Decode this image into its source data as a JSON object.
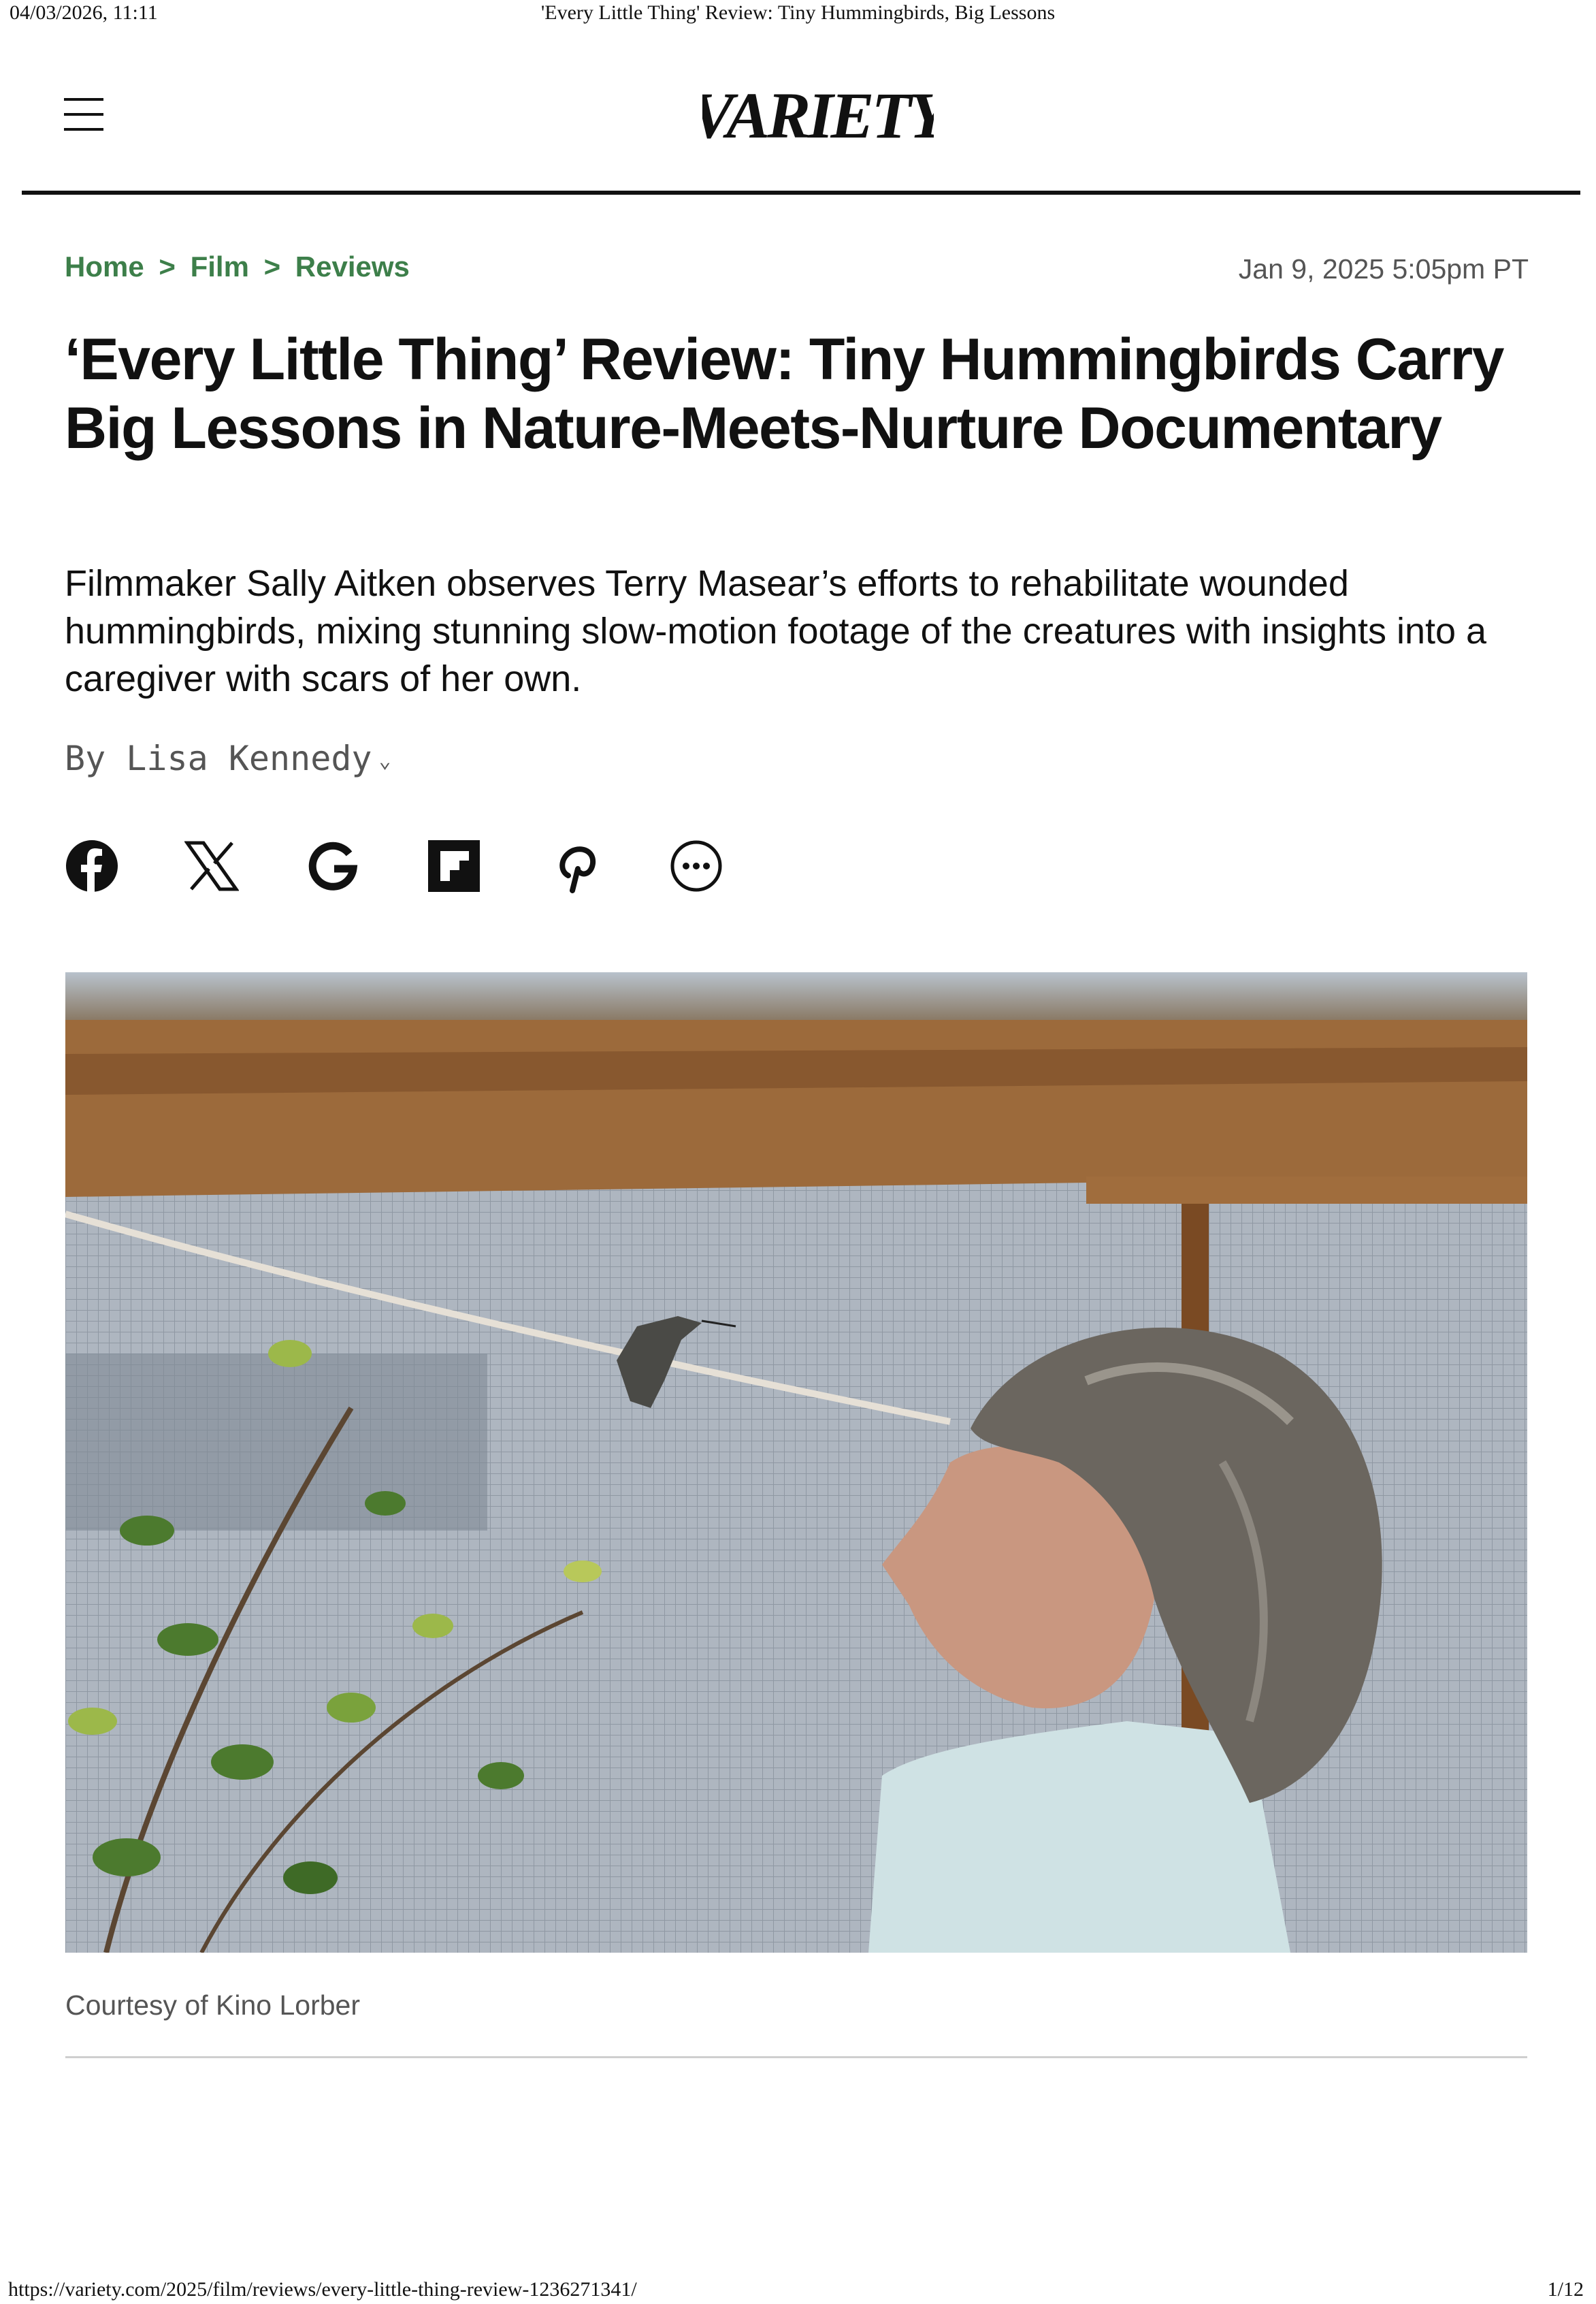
{
  "print": {
    "timestamp": "04/03/2026, 11:11",
    "document_title": "'Every Little Thing' Review: Tiny Hummingbirds, Big Lessons",
    "url": "https://variety.com/2025/film/reviews/every-little-thing-review-1236271341/",
    "page_number": "1/12"
  },
  "header": {
    "logo_text": "VARIETY",
    "menu_icon": "hamburger-menu-icon"
  },
  "breadcrumb": {
    "items": [
      "Home",
      "Film",
      "Reviews"
    ],
    "separator": ">"
  },
  "article": {
    "date": "Jan 9, 2025 5:05pm PT",
    "headline": "‘Every Little Thing’ Review: Tiny Hummingbirds Carry Big Lessons in Nature-Meets-Nurture Documentary",
    "dek": "Filmmaker Sally Aitken observes Terry Masear’s efforts to rehabilitate wounded hummingbirds, mixing stunning slow-motion footage of the creatures with insights into a caregiver with scars of her own.",
    "byline": "By Lisa Kennedy",
    "byline_icon": "chevron-down-icon",
    "image_caption": "Courtesy of Kino Lorber"
  },
  "share": {
    "icons": [
      "facebook-icon",
      "x-icon",
      "google-icon",
      "flipboard-icon",
      "pinterest-icon",
      "more-icon"
    ]
  },
  "colors": {
    "accent_green": "#3d7f4a",
    "text": "#111111",
    "muted": "#555555"
  }
}
